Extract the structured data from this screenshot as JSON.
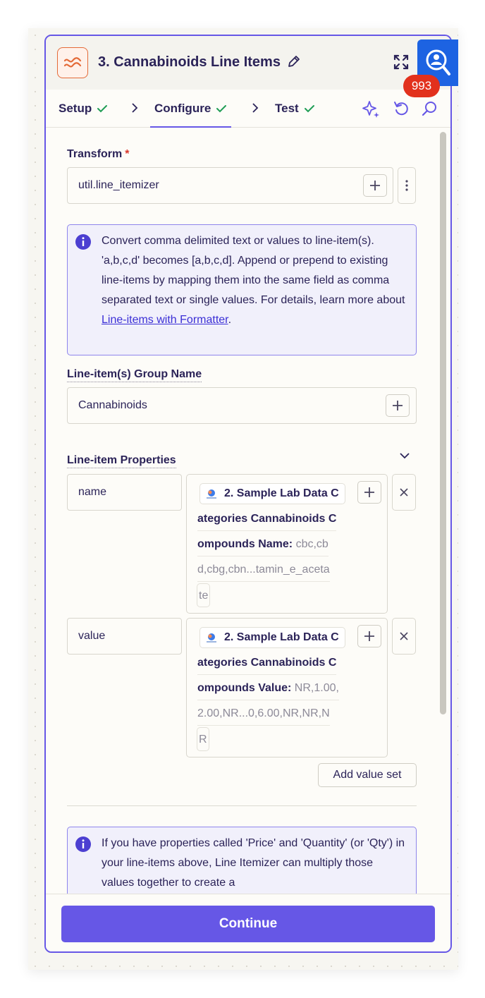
{
  "header": {
    "title": "3. Cannabinoids Line Items"
  },
  "tabs": [
    {
      "label": "Setup"
    },
    {
      "label": "Configure"
    },
    {
      "label": "Test"
    }
  ],
  "notification_count": "993",
  "transform": {
    "label": "Transform",
    "required_mark": "*",
    "value": "util.line_itemizer"
  },
  "info1": {
    "text": "Convert comma delimited text or values to line-item(s). 'a,b,c,d' becomes [a,b,c,d]. Append or prepend to existing line-items by mapping them into the same field as comma separated text or single values. For details, learn more about ",
    "link": "Line-items with Formatter",
    "end": "."
  },
  "group_name": {
    "label": "Line-item(s) Group Name",
    "value": "Cannabinoids"
  },
  "properties": {
    "label": "Line-item Properties",
    "rows": [
      {
        "key": "name",
        "lines": [
          "2. Sample Lab Data C",
          "ategories Cannabinoids C",
          "ompounds Name:",
          "d,cbg,cbn...tamin_e_aceta",
          "te"
        ],
        "value_inline": "cbc,cb"
      },
      {
        "key": "value",
        "lines": [
          "2. Sample Lab Data C",
          "ategories Cannabinoids C",
          "ompounds Value:",
          "2.00,NR...0,6.00,NR,NR,N",
          "R"
        ],
        "value_inline": "NR,1.00,"
      }
    ],
    "add_value_set": "Add value set"
  },
  "info2": {
    "text": "If you have properties called 'Price' and 'Quantity' (or 'Qty') in your line-items above, Line Itemizer can multiply those values together to create a"
  },
  "footer": {
    "continue_label": "Continue"
  },
  "colors": {
    "accent": "#6657e6",
    "success": "#1f9d55",
    "app_orange": "#e46a38",
    "badge": "#e2311d",
    "helper": "#1d63e2"
  }
}
